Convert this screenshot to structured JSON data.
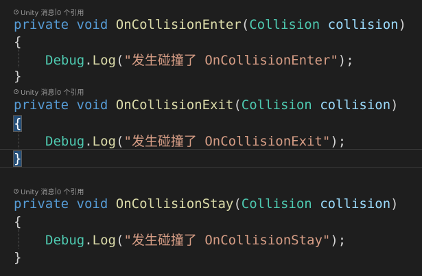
{
  "code_lens": [
    {
      "prefix": "Unity 消息",
      "sep": "|",
      "refs": "0 个引用"
    },
    {
      "prefix": "Unity 消息",
      "sep": "|",
      "refs": "0 个引用"
    },
    {
      "prefix": "Unity 消息",
      "sep": "|",
      "refs": "0 个引用"
    }
  ],
  "methods": [
    {
      "access": "private",
      "ret": "void",
      "name": "OnCollisionEnter",
      "open_paren": "(",
      "param_type": "Collision",
      "param_name": "collision",
      "close_paren": ")",
      "open_brace": "{",
      "close_brace": "}",
      "body": {
        "cls": "Debug",
        "dot": ".",
        "method": "Log",
        "lp": "(",
        "str": "\"发生碰撞了 OnCollisionEnter\"",
        "rp": ");"
      }
    },
    {
      "access": "private",
      "ret": "void",
      "name": "OnCollisionExit",
      "open_paren": "(",
      "param_type": "Collision",
      "param_name": "collision",
      "close_paren": ")",
      "open_brace": "{",
      "close_brace": "}",
      "body": {
        "cls": "Debug",
        "dot": ".",
        "method": "Log",
        "lp": "(",
        "str": "\"发生碰撞了 OnCollisionExit\"",
        "rp": ");"
      }
    },
    {
      "access": "private",
      "ret": "void",
      "name": "OnCollisionStay",
      "open_paren": "(",
      "param_type": "Collision",
      "param_name": "collision",
      "close_paren": ")",
      "open_brace": "{",
      "close_brace": "}",
      "body": {
        "cls": "Debug",
        "dot": ".",
        "method": "Log",
        "lp": "(",
        "str": "\"发生碰撞了 OnCollisionStay\"",
        "rp": ");"
      }
    }
  ]
}
